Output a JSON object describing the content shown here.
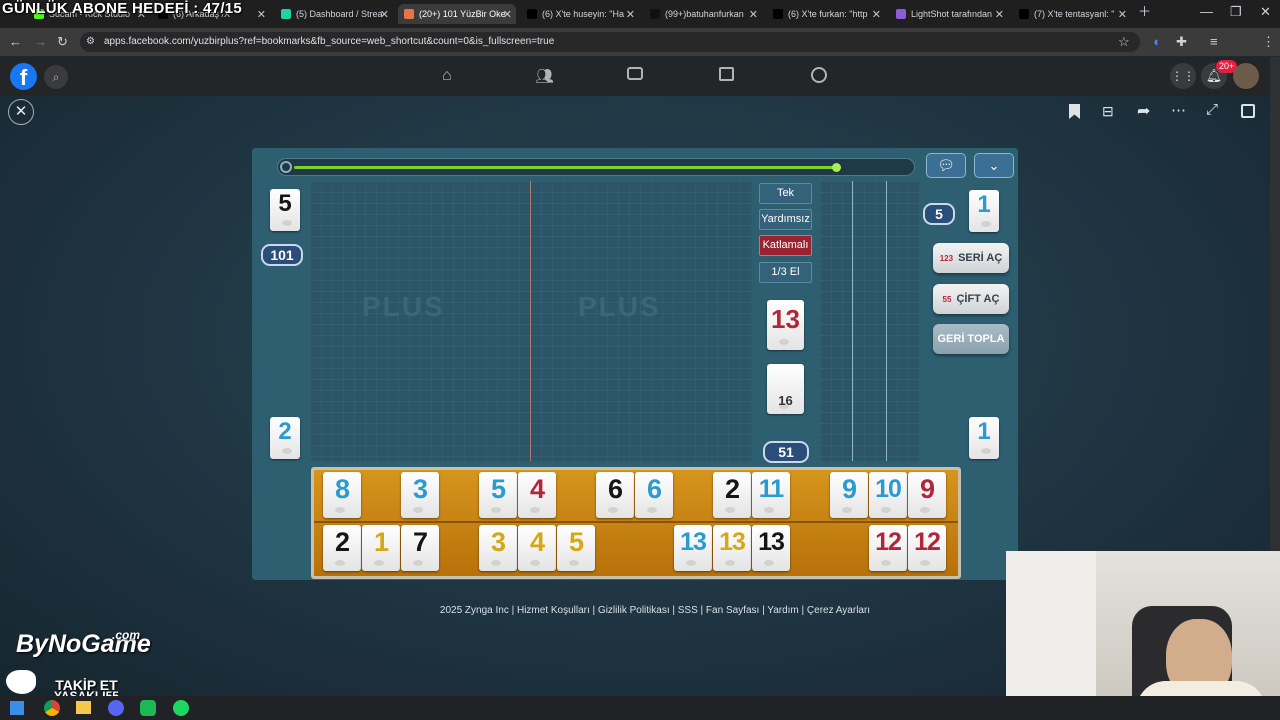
{
  "overlay_title": "GÜNLÜK ABONE HEDEFİ : 47/15",
  "tabs": [
    {
      "label": "Sucam - Kick Studio",
      "color": "#53fc18"
    },
    {
      "label": "(6) Arkadaş /X",
      "color": "#000000"
    },
    {
      "label": "(5) Dashboard / Strea",
      "color": "#1fd1a3"
    },
    {
      "label": "(20+) 101 YüzBir Oke",
      "color": "#e8744a",
      "active": true
    },
    {
      "label": "(6) X'te huseyin: \"Ha",
      "color": "#000000"
    },
    {
      "label": "(99+)batuhanfurkan",
      "color": "#111111"
    },
    {
      "label": "(6) X'te furkan: \"http",
      "color": "#000000"
    },
    {
      "label": "LightShot tarafından",
      "color": "#8a5cd6"
    },
    {
      "label": "(7) X'te tentasyanl: \"",
      "color": "#000000"
    }
  ],
  "url": "apps.facebook.com/yuzbirplus?ref=bookmarks&fb_source=web_shortcut&count=0&is_fullscreen=true",
  "notification_count": "20+",
  "game": {
    "progress": 0.88,
    "left_player_tile": "5",
    "score_badge": "101",
    "left_bottom_tile": "2",
    "modes": [
      "Tek",
      "Yardımsız",
      "Katlamalı",
      "1/3 El"
    ],
    "active_mode": "Katlamalı",
    "indicator_tile": "13",
    "deck_count": "16",
    "pool_count": "51",
    "right_badge": "5",
    "right_top_tile": "1",
    "right_bottom_tile": "1",
    "buttons": {
      "seri": "SERİ AÇ",
      "cift": "ÇİFT AÇ",
      "geri": "GERİ TOPLA"
    },
    "rack_top": [
      {
        "v": "8",
        "c": "blue"
      },
      {
        "v": "3",
        "c": "blue"
      },
      {
        "v": "5",
        "c": "blue"
      },
      {
        "v": "4",
        "c": "red"
      },
      {
        "v": "6",
        "c": "black"
      },
      {
        "v": "6",
        "c": "blue"
      },
      {
        "v": "2",
        "c": "black"
      },
      {
        "v": "11",
        "c": "blue"
      },
      {
        "v": "9",
        "c": "blue"
      },
      {
        "v": "10",
        "c": "blue"
      },
      {
        "v": "9",
        "c": "red"
      }
    ],
    "rack_bottom": [
      {
        "v": "2",
        "c": "black"
      },
      {
        "v": "1",
        "c": "yellow"
      },
      {
        "v": "7",
        "c": "black"
      },
      {
        "v": "3",
        "c": "yellow"
      },
      {
        "v": "4",
        "c": "yellow"
      },
      {
        "v": "5",
        "c": "yellow"
      },
      {
        "v": "13",
        "c": "blue"
      },
      {
        "v": "13",
        "c": "yellow"
      },
      {
        "v": "13",
        "c": "black"
      },
      {
        "v": "12",
        "c": "red"
      },
      {
        "v": "12",
        "c": "red"
      }
    ]
  },
  "footer": "2025 Zynga Inc | Hizmet Koşulları | Gizlilik Politikası | SSS | Fan Sayfası | Yardım | Çerez Ayarları",
  "watermark": {
    "brand": "ByNoGame",
    "domain": ".com",
    "cta_line1": "TAKİP ET",
    "cta_line2": "YASAKLI55"
  }
}
